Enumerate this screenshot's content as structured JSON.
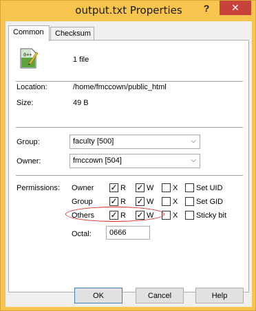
{
  "window": {
    "title": "output.txt Properties",
    "help_glyph": "?",
    "close_glyph": "✕"
  },
  "tabs": [
    {
      "label": "Common",
      "active": true
    },
    {
      "label": "Checksum",
      "active": false
    }
  ],
  "summary": {
    "icon": "text-file-icon",
    "file_count": "1 file"
  },
  "info": {
    "location_label": "Location:",
    "location_value": "/home/fmccown/public_html",
    "size_label": "Size:",
    "size_value": "49 B"
  },
  "ownership": {
    "group_label": "Group:",
    "group_value": "faculty [500]",
    "owner_label": "Owner:",
    "owner_value": "fmccown [504]"
  },
  "permissions": {
    "label": "Permissions:",
    "rows": [
      {
        "name": "Owner",
        "r": true,
        "w": true,
        "x": false,
        "extra_label": "Set UID",
        "extra": false
      },
      {
        "name": "Group",
        "r": true,
        "w": true,
        "x": false,
        "extra_label": "Set GID",
        "extra": false
      },
      {
        "name": "Others",
        "r": true,
        "w": true,
        "x": false,
        "extra_label": "Sticky bit",
        "extra": false
      }
    ],
    "r_label": "R",
    "w_label": "W",
    "x_label": "X",
    "octal_label": "Octal:",
    "octal_value": "0666",
    "highlight_color": "#dd2222"
  },
  "buttons": {
    "ok": "OK",
    "cancel": "Cancel",
    "help": "Help"
  },
  "colors": {
    "title_bar": "#f7c44e",
    "close_button": "#c7423a"
  }
}
